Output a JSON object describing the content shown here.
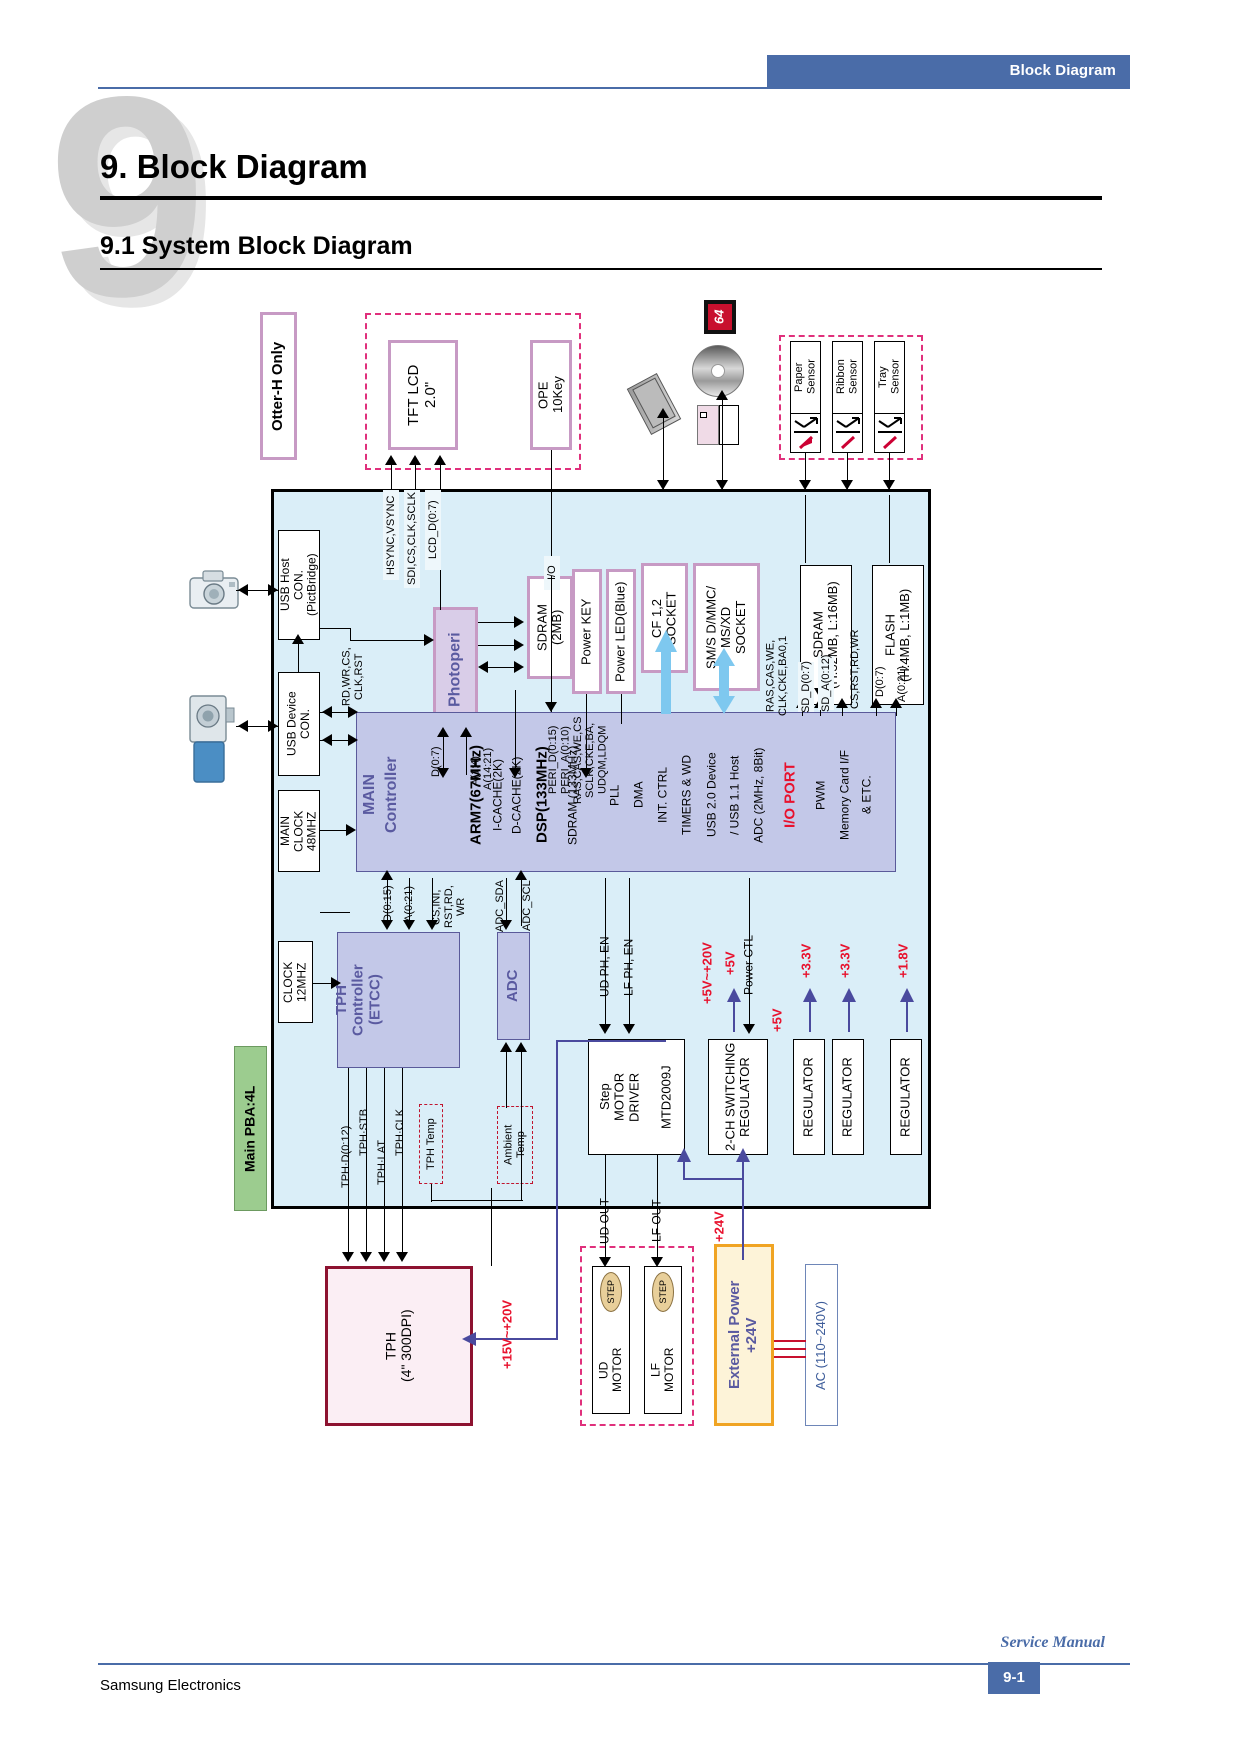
{
  "header": {
    "band_label": "Block Diagram"
  },
  "titles": {
    "chapter_number": "9",
    "h1": "9. Block Diagram",
    "h2": "9.1 System Block Diagram"
  },
  "footer": {
    "company": "Samsung Electronics",
    "manual": "Service Manual",
    "page": "9-1"
  },
  "diagram": {
    "variant_note": "Otter-H Only",
    "boards": {
      "main_pba": "Main PBA:4L",
      "tph": "TPH\n(4\" 300DPI)",
      "external_power": "External Power\n+24V",
      "ac_input": "AC (110~240V)"
    },
    "peripherals": {
      "tft_lcd": "TFT LCD\n2.0\"",
      "ope": "OPE\n10Key",
      "usb_host": "USB Host\nCON.\n(PictBridge)",
      "usb_device": "USB Device\nCON.",
      "main_clock": "MAIN\nCLOCK\n48MHZ",
      "clock_12": "CLOCK\n12MHZ",
      "cf_label": "64"
    },
    "sensors": [
      {
        "name": "Paper\nSensor"
      },
      {
        "name": "Ribbon\nSensor"
      },
      {
        "name": "Tray\nSensor"
      }
    ],
    "blocks": {
      "photoperi": "Photoperi",
      "sdram_2mb": "SDRAM\n(2MB)",
      "power_key": "Power KEY",
      "power_led": "Power LED(Blue)",
      "cf_socket": "CF 1,2\nSOCKET",
      "smsd_socket": "SM/S D/MMC/\nMS/XD\nSOCKET",
      "sdram_main": "SDRAM\n(H:32MB, L:16MB)",
      "flash": "FLASH\n(H:4MB, L:1MB)",
      "tph_controller": "TPH\nController\n(ETCC)",
      "adc": "ADC",
      "step_motor_driver": "Step\nMOTOR\nDRIVER",
      "step_motor_part": "MTD2009J",
      "switching_reg": "2-CH SWITCHING\nREGULATOR",
      "regulator": "REGULATOR",
      "tph_temp": "TPH Temp",
      "ambient_temp": "Ambient\nTemp",
      "ud_motor": "UD\nMOTOR",
      "lf_motor": "LF\nMOTOR",
      "step_tag": "STEP"
    },
    "main_controller": {
      "title_line1": "MAIN",
      "title_line2": "Controller",
      "cpu": "ARM7(67MHz)",
      "icache": "I-CACHE(2K)",
      "dcache": "D-CACHE(2K)",
      "dsp": "DSP(133MHz)",
      "sdram_if": "SDRAM (133MHz)",
      "pll": "PLL",
      "dma": "DMA",
      "int_ctrl": "INT. CTRL",
      "timers": "TIMERS & WD",
      "usb20": "USB 2.0 Device",
      "usb11": "/ USB 1.1 Host",
      "adc_spec": "ADC (2MHz, 8Bit)",
      "io_port": "I/O PORT",
      "pwm": "PWM",
      "memcard": "Memory Card I/F",
      "etc": "& ETC."
    },
    "bus_labels": {
      "hsync": "HSYNC,VSYNC",
      "sdi": "SDI,CS,CLK,SCLK",
      "lcd_d": "LCD_D(0:7)",
      "rd_wr": "RD,WR,CS,\nCLK,RST",
      "d07": "D(0:7)",
      "a14": "A(1:4),\nA(14:21)",
      "peri": "PERI_D(0:15)\nPERI_A(0:10)\nRAS,CAS,WE,CS\nSCLK,CKE,BA,\nUDQM,LDQM",
      "io": "I/O",
      "ras_cas": "RAS,CAS,WE,\nCLK,CKE,BA0,1",
      "sd_d": "SD_D(0:7)",
      "sd_a": "SD_A(0:12)",
      "cs_rst": "CS,RST,RD,WR",
      "flash_d": "D(0:7)",
      "flash_a": "A(0:21)",
      "d015": "D(0:15)",
      "a021": "A(0:21)",
      "cs_ini": "CS,INI,\nRST,RD,\nWR",
      "adc_sda": "ADC_SDA",
      "adc_scl": "ADC_SCL",
      "ud_ph": "UD PH, EN",
      "lf_ph": "LF PH, EN",
      "power_ctl": "Power CTL",
      "tph_d": "TPH·D(0:12)",
      "tph_stb": "TPH·STB",
      "tph_lat": "TPH·LAT",
      "tph_clk": "TPH·CLK",
      "ud_out": "UD OUT",
      "lf_out": "LF OUT"
    },
    "voltages": {
      "v5_20": "+5V~+20V",
      "v5a": "+5V",
      "v5b": "+5V",
      "v33a": "+3.3V",
      "v33b": "+3.3V",
      "v18": "+1.8V",
      "v24": "+24V",
      "v15_20": "+15V~+20V"
    },
    "colors": {
      "accent": "#4a6ca8",
      "pink_dash": "#e0307c",
      "red_text": "#e8112d",
      "controller_fill": "#c3c8e8",
      "board_fill": "#dcf0f9",
      "green": "#9ccc8f",
      "orange": "#f0a423",
      "tph_border": "#8d1230"
    }
  }
}
